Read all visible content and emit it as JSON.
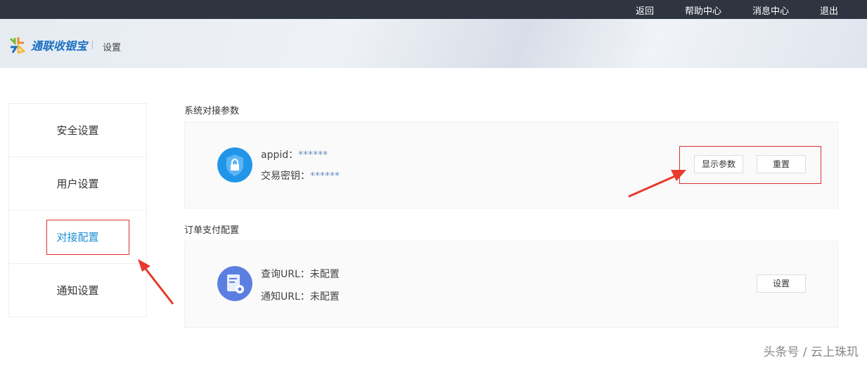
{
  "topbar": {
    "back": "返回",
    "help": "帮助中心",
    "messages": "消息中心",
    "logout": "退出"
  },
  "header": {
    "logo": "通联收银宝",
    "title": "设置"
  },
  "sidebar": {
    "items": [
      {
        "label": "安全设置"
      },
      {
        "label": "用户设置"
      },
      {
        "label": "对接配置"
      },
      {
        "label": "通知设置"
      }
    ]
  },
  "section1": {
    "title": "系统对接参数",
    "appid_label": "appid：",
    "appid_value": "******",
    "key_label": "交易密钥：",
    "key_value": "******",
    "show_button": "显示参数",
    "reset_button": "重置"
  },
  "section2": {
    "title": "订单支付配置",
    "query_label": "查询URL：",
    "query_value": "未配置",
    "notify_label": "通知URL：",
    "notify_value": "未配置",
    "set_button": "设置"
  },
  "watermark": "头条号 / 云上珠玑"
}
